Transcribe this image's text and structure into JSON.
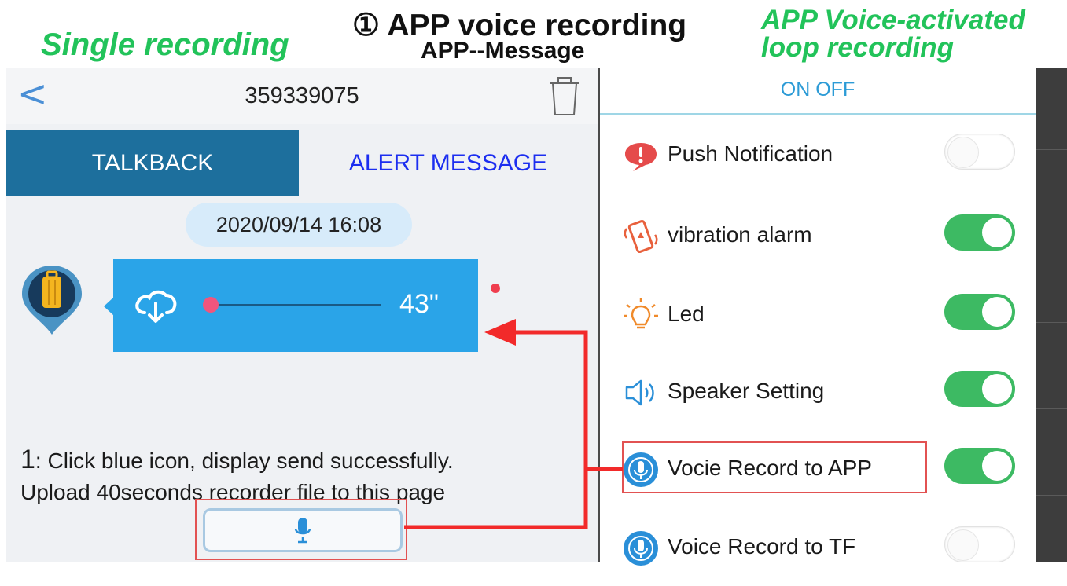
{
  "captions": {
    "left": "Single recording",
    "center_title": "① APP voice recording",
    "center_sub": "APP--Message",
    "right_line1": "APP Voice-activated",
    "right_line2": "loop recording"
  },
  "chat": {
    "back_icon": "chevron-left-icon",
    "device_id": "359339075",
    "trash_icon": "trash-icon",
    "tabs": [
      {
        "label": "TALKBACK",
        "active": true
      },
      {
        "label": "ALERT MESSAGE",
        "active": false
      }
    ],
    "date": "2020/09/14 16:08",
    "message": {
      "avatar_icon": "luggage-icon",
      "download_icon": "cloud-download-icon",
      "duration": "43\"",
      "progress": 0
    },
    "instruction_num": "1",
    "instruction_line1": ": Click blue icon, display send successfully.",
    "instruction_line2": "Upload 40seconds  recorder file to this page",
    "mic_icon": "microphone-icon"
  },
  "settings": {
    "header": "ON OFF",
    "rows": [
      {
        "label": "Push Notification",
        "icon": "alert-bubble-icon",
        "on": false
      },
      {
        "label": "vibration alarm",
        "icon": "vibrating-phone-icon",
        "on": true
      },
      {
        "label": "Led",
        "icon": "lightbulb-icon",
        "on": true
      },
      {
        "label": "Speaker Setting",
        "icon": "speaker-icon",
        "on": true
      },
      {
        "label": "Vocie Record to APP",
        "icon": "mic-circle-icon",
        "on": true
      },
      {
        "label": "Voice Record to TF",
        "icon": "mic-circle-icon",
        "on": false
      }
    ]
  },
  "colors": {
    "accent_green": "#22c35a",
    "talkback_blue": "#1d6f9d",
    "bubble_blue": "#2aa4e8",
    "toggle_on": "#3dba63",
    "highlight_red": "#e25252"
  }
}
